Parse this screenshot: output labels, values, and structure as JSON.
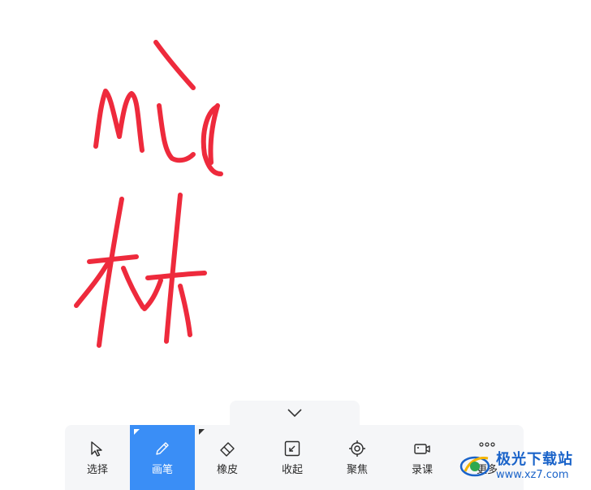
{
  "toolbar": {
    "collapse_icon": "chevron-down-icon",
    "tools": [
      {
        "label": "选择",
        "icon": "cursor-arrow-icon"
      },
      {
        "label": "画笔",
        "icon": "pen-icon",
        "active": true
      },
      {
        "label": "橡皮",
        "icon": "eraser-icon"
      },
      {
        "label": "收起",
        "icon": "minimize-icon"
      },
      {
        "label": "聚焦",
        "icon": "focus-target-icon"
      },
      {
        "label": "录课",
        "icon": "video-camera-icon"
      },
      {
        "label": "更多",
        "icon": "more-dots-icon"
      }
    ],
    "active_color": "#3a8ef6"
  },
  "canvas": {
    "ink_color": "#ee2a3c"
  },
  "watermark": {
    "title": "极光下载站",
    "url": "www.xz7.com"
  }
}
